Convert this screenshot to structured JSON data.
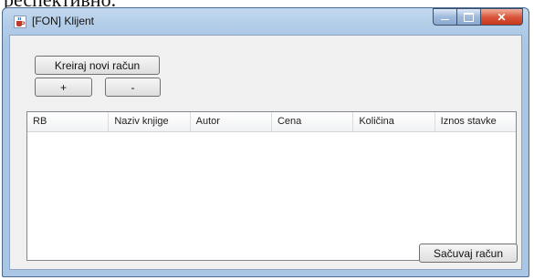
{
  "background_text": "респективно.",
  "window": {
    "title": "[FON] Klijent",
    "close_glyph": "✕",
    "max_glyph": "▫",
    "min_glyph": "—"
  },
  "buttons": {
    "new_invoice": "Kreiraj novi račun",
    "plus": "+",
    "minus": "-",
    "save_invoice": "Sačuvaj račun"
  },
  "table": {
    "columns": [
      "RB",
      "Naziv knjige",
      "Autor",
      "Cena",
      "Količina",
      "Iznos stavke"
    ],
    "rows": []
  },
  "colors": {
    "title_bar": "#b3cde8",
    "close_button": "#d9583c",
    "client_bg": "#f0f0f0"
  },
  "icons": {
    "app": "java-coffee-cup-icon"
  }
}
